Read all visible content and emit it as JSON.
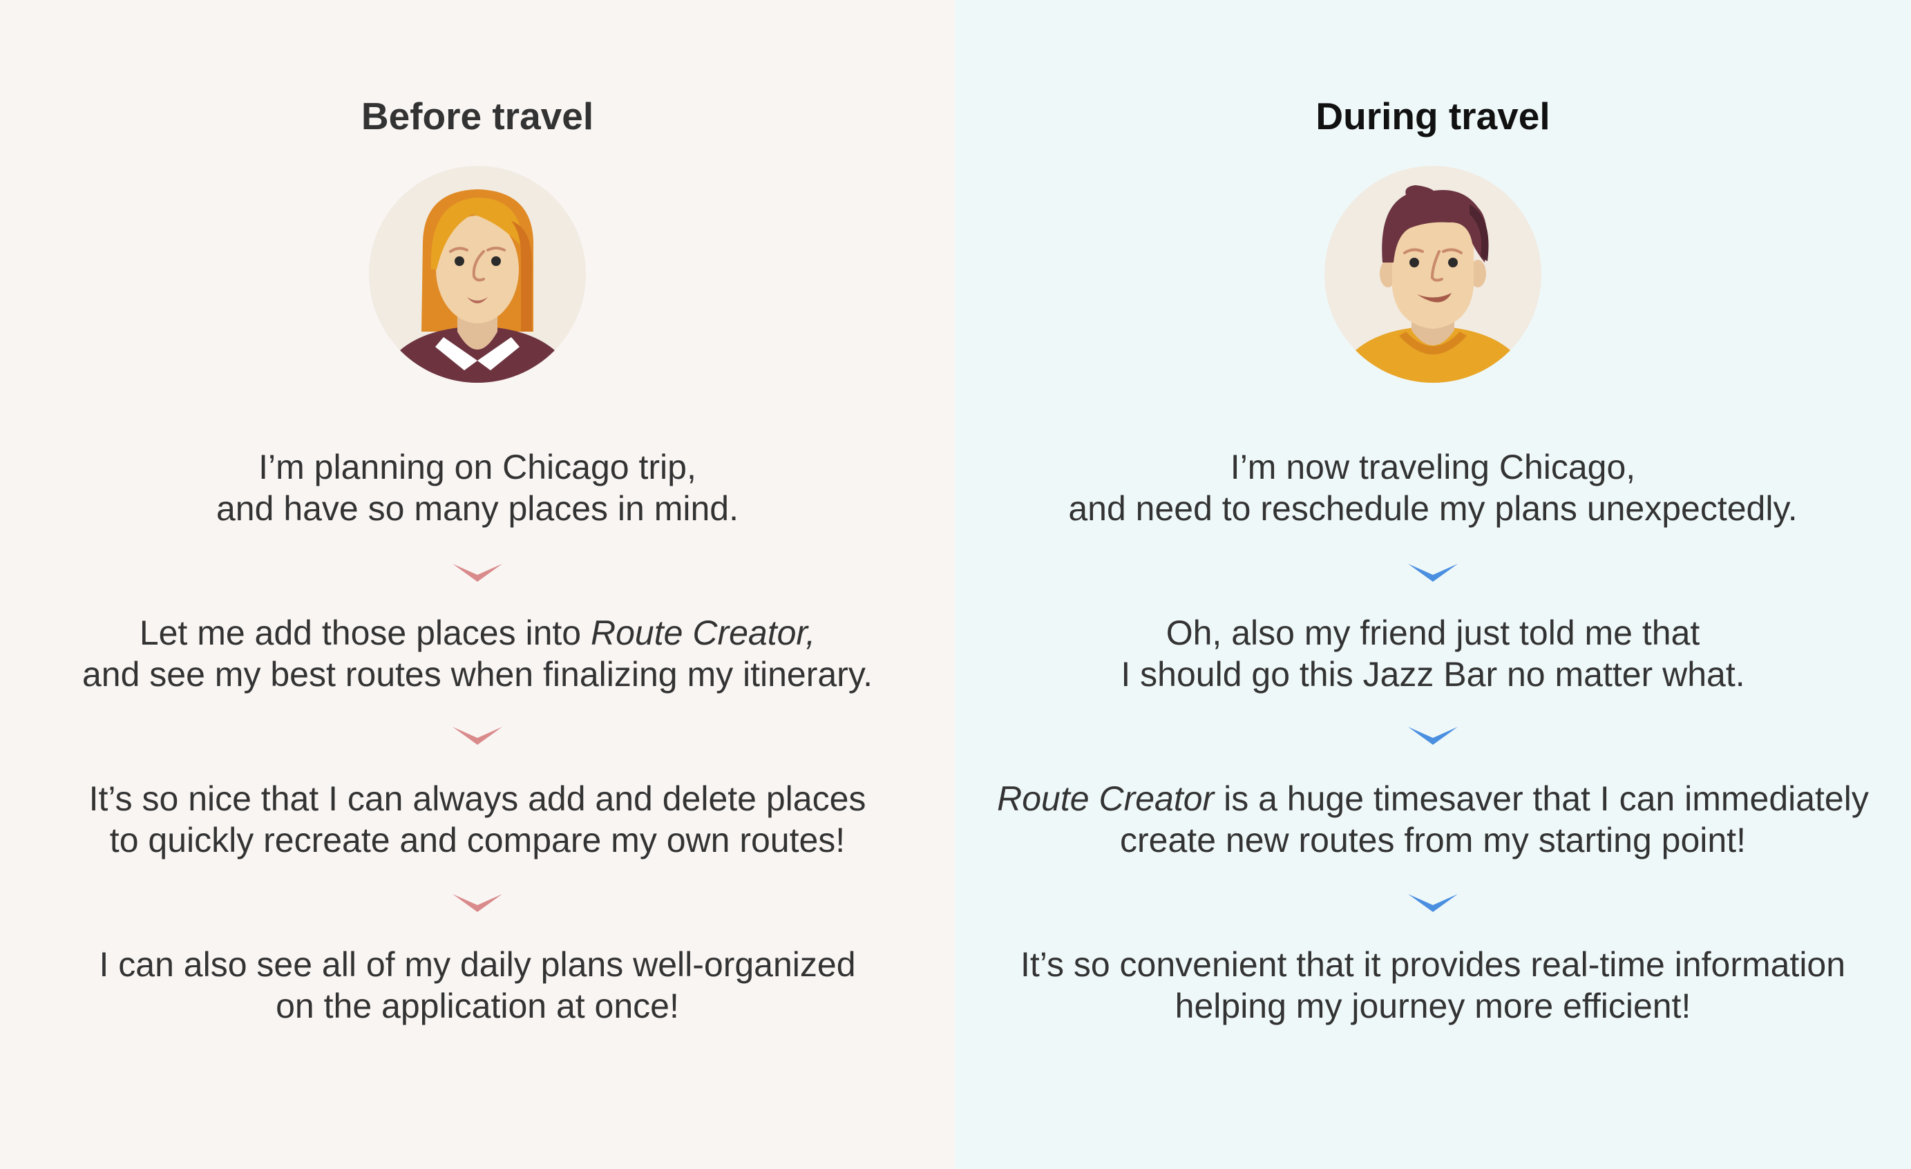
{
  "colors": {
    "left_background": "#f9f5f3",
    "right_background": "#eff8f9",
    "left_chevron": "#d98a8a",
    "right_chevron": "#4a8fe0",
    "text": "#333333"
  },
  "before": {
    "heading": "Before travel",
    "avatar_icon": "woman-avatar-icon",
    "chevron_icon": "chevron-down-icon",
    "steps": [
      {
        "line1": "I’m planning on Chicago trip,",
        "line2": "and have so many places in mind."
      },
      {
        "line1_pre": "Let me add those places into ",
        "line1_em": "Route Creator,",
        "line2": "and see my best routes when finalizing my itinerary."
      },
      {
        "line1": "It’s so nice that I can always add and delete places",
        "line2": "to quickly recreate and compare my own routes!"
      },
      {
        "line1": "I can also see all of my daily plans well-organized",
        "line2": "on the application at once!"
      }
    ]
  },
  "during": {
    "heading": "During travel",
    "avatar_icon": "man-avatar-icon",
    "chevron_icon": "chevron-down-icon",
    "steps": [
      {
        "line1": "I’m now traveling Chicago,",
        "line2": "and need to reschedule my plans unexpectedly."
      },
      {
        "line1": "Oh, also my friend just told me that",
        "line2": "I should go this Jazz Bar no matter what."
      },
      {
        "line1_em": "Route Creator",
        "line1_post": " is a huge timesaver that I can immediately",
        "line2": "create new routes from my starting point!"
      },
      {
        "line1": "It’s so convenient that it provides real-time information",
        "line2": "helping my journey more efficient!"
      }
    ]
  }
}
